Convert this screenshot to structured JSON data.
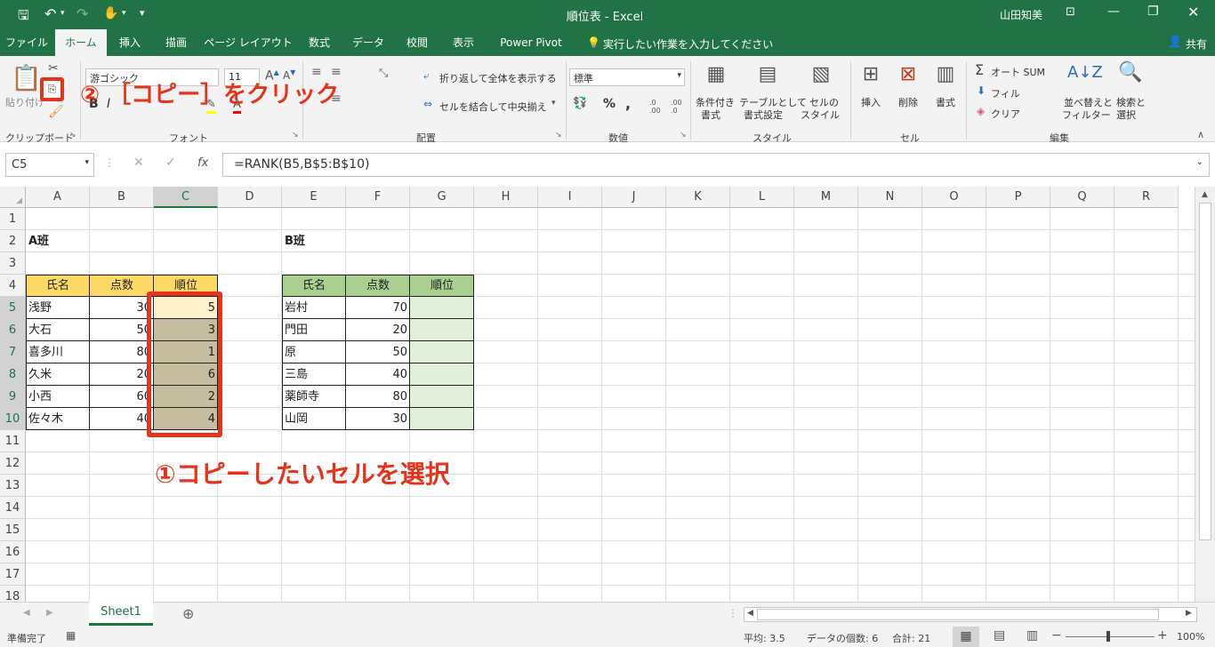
{
  "titlebar": {
    "title": "順位表  -  Excel",
    "user": "山田知美",
    "qat_save_icon": "save-icon",
    "qat_undo_icon": "undo-icon",
    "qat_redo_icon": "redo-icon",
    "qat_touch_icon": "touch-mode-icon",
    "qat_customize": "▾"
  },
  "tabs": [
    "ファイル",
    "ホーム",
    "挿入",
    "描画",
    "ページ レイアウト",
    "数式",
    "データ",
    "校閲",
    "表示",
    "Power Pivot"
  ],
  "tell_me": "実行したい作業を入力してください",
  "share": "共有",
  "ribbon": {
    "clipboard": {
      "group": "クリップボード",
      "paste": "貼り付け"
    },
    "font": {
      "group": "フォント",
      "font_name": "游ゴシック",
      "font_size": "11",
      "bold": "B",
      "italic": "I"
    },
    "alignment": {
      "group": "配置",
      "wrap": "折り返して全体を表示する",
      "merge": "セルを結合して中央揃え"
    },
    "number": {
      "group": "数値",
      "format": "標準",
      "percent": "%",
      "comma": ","
    },
    "styles": {
      "group": "スタイル",
      "cond_1": "条件付き",
      "cond_2": "書式",
      "table_1": "テーブルとして",
      "table_2": "書式設定",
      "cell_1": "セルの",
      "cell_2": "スタイル"
    },
    "cells": {
      "group": "セル",
      "insert": "挿入",
      "delete": "削除",
      "format": "書式"
    },
    "editing": {
      "group": "編集",
      "autosum": "オート SUM",
      "fill": "フィル",
      "clear": "クリア",
      "sort_1": "並べ替えと",
      "sort_2": "フィルター",
      "find_1": "検索と",
      "find_2": "選択"
    }
  },
  "formula_bar": {
    "name_box": "C5",
    "fx": "fx",
    "formula": "=RANK(B5,B$5:B$10)"
  },
  "columns": [
    "A",
    "B",
    "C",
    "D",
    "E",
    "F",
    "G",
    "H",
    "I",
    "J",
    "K",
    "L",
    "M",
    "N",
    "O",
    "P",
    "Q",
    "R"
  ],
  "rows": [
    "1",
    "2",
    "3",
    "4",
    "5",
    "6",
    "7",
    "8",
    "9",
    "10",
    "11",
    "12",
    "13",
    "14",
    "15",
    "16",
    "17",
    "18"
  ],
  "table_a": {
    "title": "A班",
    "headers": [
      "氏名",
      "点数",
      "順位"
    ],
    "rows": [
      [
        "浅野",
        "30",
        "5"
      ],
      [
        "大石",
        "50",
        "3"
      ],
      [
        "喜多川",
        "80",
        "1"
      ],
      [
        "久米",
        "20",
        "6"
      ],
      [
        "小西",
        "60",
        "2"
      ],
      [
        "佐々木",
        "40",
        "4"
      ]
    ]
  },
  "table_b": {
    "title": "B班",
    "headers": [
      "氏名",
      "点数",
      "順位"
    ],
    "rows": [
      [
        "岩村",
        "70",
        ""
      ],
      [
        "門田",
        "20",
        ""
      ],
      [
        "原",
        "50",
        ""
      ],
      [
        "三島",
        "40",
        ""
      ],
      [
        "薬師寺",
        "80",
        ""
      ],
      [
        "山岡",
        "30",
        ""
      ]
    ]
  },
  "callouts": {
    "step2": "② ［コピー］をクリック",
    "step1": "①コピーしたいセルを選択"
  },
  "sheet_tab": "Sheet1",
  "status": {
    "ready": "準備完了",
    "average": "平均: 3.5",
    "count": "データの個数: 6",
    "sum": "合計: 21",
    "zoom": "100%"
  },
  "colors": {
    "excel_green": "#217346",
    "header_a": "#ffd966",
    "header_b": "#a9d08e",
    "body_b": "#e2efda",
    "selection": "#c6bc9f",
    "callout": "#e8331c"
  }
}
